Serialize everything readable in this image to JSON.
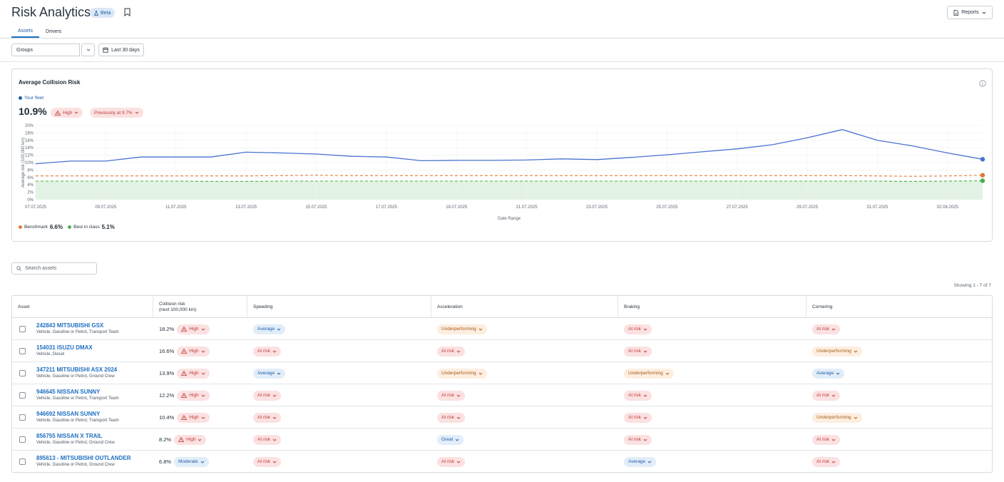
{
  "header": {
    "title": "Risk Analytics",
    "beta_label": "Beta",
    "reports_label": "Reports"
  },
  "tabs": [
    {
      "label": "Assets",
      "active": true
    },
    {
      "label": "Drivers",
      "active": false
    }
  ],
  "filters": {
    "groups_value": "Groups",
    "date_label": "Last 30 days"
  },
  "chart_card": {
    "title": "Average Collision Risk",
    "fleet_legend": "Your fleet",
    "current_value": "10.9%",
    "level_label": "High",
    "previous_label": "Previously at 9.7%",
    "benchmark_label": "Benchmark",
    "benchmark_value": "6.6%",
    "best_label": "Best in class",
    "best_value": "5.1%"
  },
  "chart_data": {
    "type": "line",
    "xlabel": "Date Range",
    "ylabel": "Average risk (100,000 km)",
    "ylim": [
      0,
      20
    ],
    "yticks": [
      "0%",
      "2%",
      "4%",
      "6%",
      "8%",
      "10%",
      "12%",
      "14%",
      "16%",
      "18%",
      "20%"
    ],
    "x": [
      "07.07.2025",
      "08.07.2025",
      "09.07.2025",
      "10.07.2025",
      "11.07.2025",
      "12.07.2025",
      "13.07.2025",
      "14.07.2025",
      "15.07.2025",
      "16.07.2025",
      "17.07.2025",
      "18.07.2025",
      "19.07.2025",
      "20.07.2025",
      "21.07.2025",
      "22.07.2025",
      "23.07.2025",
      "24.07.2025",
      "25.07.2025",
      "26.07.2025",
      "27.07.2025",
      "28.07.2025",
      "29.07.2025",
      "30.07.2025",
      "31.07.2025",
      "01.08.2025",
      "02.08.2025",
      "03.08.2025"
    ],
    "xtick_labels": [
      "07.07.2025",
      "09.07.2025",
      "11.07.2025",
      "13.07.2025",
      "15.07.2025",
      "17.07.2025",
      "19.07.2025",
      "21.07.2025",
      "23.07.2025",
      "25.07.2025",
      "27.07.2025",
      "29.07.2025",
      "31.07.2025",
      "02.08.2025"
    ],
    "series": [
      {
        "name": "Your fleet",
        "color": "#4a72d1",
        "style": "solid",
        "values": [
          9.7,
          10.4,
          10.4,
          11.5,
          11.5,
          11.5,
          12.8,
          12.6,
          12.3,
          11.7,
          11.5,
          10.5,
          10.6,
          10.6,
          10.7,
          11.0,
          10.8,
          11.4,
          12.1,
          12.9,
          13.7,
          14.8,
          16.7,
          18.9,
          16.0,
          14.5,
          12.6,
          10.9
        ]
      },
      {
        "name": "Benchmark",
        "color": "#e07b39",
        "style": "dashed",
        "values": [
          6.4,
          6.4,
          6.4,
          6.4,
          6.4,
          6.4,
          6.4,
          6.5,
          6.6,
          6.5,
          6.5,
          6.5,
          6.5,
          6.5,
          6.5,
          6.5,
          6.5,
          6.5,
          6.5,
          6.5,
          6.5,
          6.5,
          6.5,
          6.5,
          6.4,
          6.3,
          6.4,
          6.6
        ]
      },
      {
        "name": "Best in class",
        "color": "#4caf50",
        "style": "dashed",
        "values": [
          5.0,
          5.0,
          5.0,
          5.0,
          5.0,
          4.9,
          4.9,
          5.0,
          5.0,
          5.0,
          5.0,
          5.0,
          5.0,
          5.0,
          5.0,
          5.0,
          5.0,
          5.0,
          5.0,
          5.0,
          5.0,
          5.0,
          5.0,
          5.0,
          5.0,
          4.9,
          5.0,
          5.1
        ]
      }
    ],
    "band": {
      "from": 0,
      "to": 5.1,
      "color": "#e3f3e3"
    },
    "grid": true
  },
  "search": {
    "placeholder": "Search assets"
  },
  "showing_label": "Showing 1 - 7 of 7",
  "table": {
    "headers": [
      "Asset",
      "Collision risk\n(next 100,000 km)",
      "Speeding",
      "Acceleration",
      "Braking",
      "Cornering"
    ],
    "rows": [
      {
        "name": "242843 MITSUBISHI GSX",
        "sub": "Vehicle, Gasoline or Petrol, Transport Team",
        "risk": "18.2%",
        "level": "High",
        "speeding": "Average",
        "acceleration": "Underperforming",
        "braking": "At risk",
        "cornering": "At risk"
      },
      {
        "name": "154031 ISUZU DMAX",
        "sub": "Vehicle, Diesel",
        "risk": "16.6%",
        "level": "High",
        "speeding": "At risk",
        "acceleration": "At risk",
        "braking": "At risk",
        "cornering": "Underperforming"
      },
      {
        "name": "347211 MITSUBISHI ASX 2024",
        "sub": "Vehicle, Gasoline or Petrol, Ground Crew",
        "risk": "13.9%",
        "level": "High",
        "speeding": "Average",
        "acceleration": "Underperforming",
        "braking": "Underperforming",
        "cornering": "Average"
      },
      {
        "name": "946645 NISSAN SUNNY",
        "sub": "Vehicle, Gasoline or Petrol, Transport Team",
        "risk": "12.2%",
        "level": "High",
        "speeding": "At risk",
        "acceleration": "At risk",
        "braking": "At risk",
        "cornering": "At risk"
      },
      {
        "name": "946692 NISSAN SUNNY",
        "sub": "Vehicle, Gasoline or Petrol, Transport Team",
        "risk": "10.4%",
        "level": "High",
        "speeding": "At risk",
        "acceleration": "At risk",
        "braking": "At risk",
        "cornering": "Underperforming"
      },
      {
        "name": "856755 NISSAN X TRAIL",
        "sub": "Vehicle, Gasoline or Petrol, Ground Crew",
        "risk": "8.2%",
        "level": "High",
        "speeding": "At risk",
        "acceleration": "Great",
        "braking": "At risk",
        "cornering": "At risk"
      },
      {
        "name": "895613 - MITSUBISHI OUTLANDER",
        "sub": "Vehicle, Gasoline or Petrol, Ground Crew",
        "risk": "6.8%",
        "level": "Moderate",
        "speeding": "At risk",
        "acceleration": "At risk",
        "braking": "Average",
        "cornering": "At risk"
      }
    ]
  }
}
